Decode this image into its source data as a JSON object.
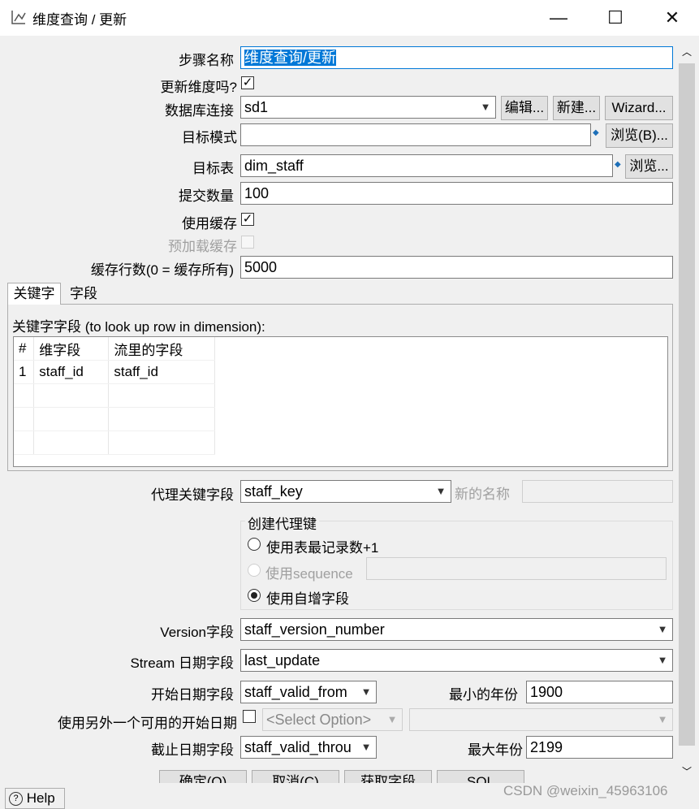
{
  "window": {
    "title": "维度查询 / 更新",
    "minimize": "—",
    "maximize": "☐",
    "close": "✕"
  },
  "form": {
    "step_name_label": "步骤名称",
    "step_name_value": "维度查询/更新",
    "update_dim_label": "更新维度吗?",
    "db_conn_label": "数据库连接",
    "db_conn_value": "sd1",
    "edit_btn": "编辑...",
    "new_btn": "新建...",
    "wizard_btn": "Wizard...",
    "target_schema_label": "目标模式",
    "target_schema_value": "",
    "browse_b_btn": "浏览(B)...",
    "target_table_label": "目标表",
    "target_table_value": "dim_staff",
    "browse_btn": "浏览...",
    "commit_label": "提交数量",
    "commit_value": "100",
    "use_cache_label": "使用缓存",
    "preload_cache_label": "预加载缓存",
    "cache_rows_label": "缓存行数(0 = 缓存所有)",
    "cache_rows_value": "5000"
  },
  "tabs": {
    "keys": "关键字",
    "fields": "字段"
  },
  "keys_panel": {
    "caption": "关键字字段 (to look up row in dimension):",
    "headers": [
      "#",
      "维字段",
      "流里的字段"
    ],
    "rows": [
      {
        "n": "1",
        "dim": "staff_id",
        "stream": "staff_id"
      }
    ]
  },
  "surrogate": {
    "label": "代理关键字段",
    "value": "staff_key",
    "new_name_label": "新的名称",
    "new_name_value": "",
    "group_title": "创建代理键",
    "opt_max": "使用表最记录数+1",
    "opt_seq": "使用sequence",
    "opt_auto": "使用自增字段"
  },
  "dates": {
    "version_label": "Version字段",
    "version_value": "staff_version_number",
    "stream_date_label": "Stream 日期字段",
    "stream_date_value": "last_update",
    "start_date_label": "开始日期字段",
    "start_date_value": "staff_valid_from",
    "min_year_label": "最小的年份",
    "min_year_value": "1900",
    "alt_start_label": "使用另外一个可用的开始日期",
    "alt_start_select": "<Select Option>",
    "end_date_label": "截止日期字段",
    "end_date_value": "staff_valid_throu",
    "max_year_label": "最大年份",
    "max_year_value": "2199"
  },
  "footer": {
    "ok_btn": "确定(O)",
    "cancel_btn": "取消(C)",
    "get_fields_btn": "获取字段",
    "sql_btn": "SQL",
    "help_btn": "Help",
    "watermark": "CSDN @weixin_45963106"
  }
}
